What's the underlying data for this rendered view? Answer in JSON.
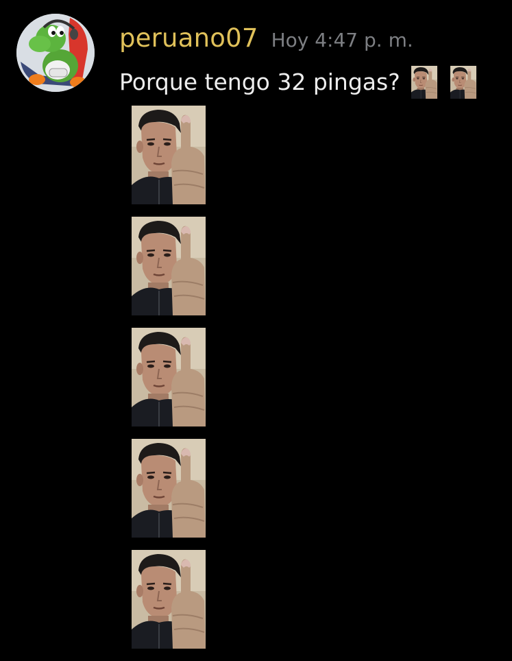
{
  "message": {
    "author": "peruano07",
    "timestamp": "Hoy 4:47 p. m.",
    "text": "Porque tengo 32 pingas?",
    "avatar_icon": "yoshi-gamer-avatar",
    "inline_emoji_icon": "middle-finger-selfie-emoji",
    "inline_emoji_count": 2,
    "sticker_count": 5,
    "colors": {
      "background": "#000000",
      "username": "#e0c15a",
      "timestamp": "#7d7f83",
      "text": "#eeeeee"
    }
  }
}
